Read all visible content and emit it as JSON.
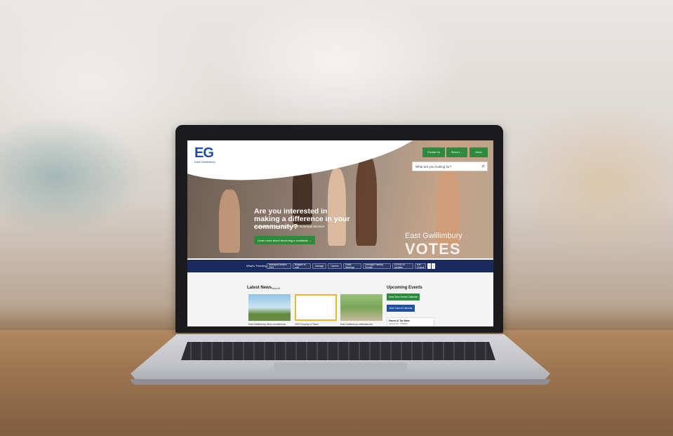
{
  "site": {
    "logo_text": "EG",
    "logo_sub": "East Gwillimbury",
    "header_buttons": [
      "Contact Us",
      "Select L...",
      "Menu"
    ],
    "search": {
      "placeholder": "What are you looking for?"
    }
  },
  "hero": {
    "headline": "Are you interested in making a difference in your community?",
    "subtext": "Registration is open for the 2022 municipal Election",
    "cta_label": "Learn more about becoming a candidate →",
    "badge_line1": "East Gwillimbury",
    "badge_line2": "VOTES"
  },
  "trending": {
    "label": "What's Trending",
    "items": [
      "Municipal Election 2022",
      "Register to vote",
      "Garbage",
      "Careers",
      "Public Meetings",
      "Overnight Parking Permits",
      "COVID-19 Updates",
      "Live Council"
    ]
  },
  "news": {
    "heading": "Latest News",
    "view_all": "View All",
    "items": [
      {
        "title": "East Gwillimbury offers condolences"
      },
      {
        "title": "2022 Property of Taxes"
      },
      {
        "title": "East Gwillimbury celebrates the"
      }
    ]
  },
  "events": {
    "heading": "Upcoming Events",
    "btn_town": "View Town Events Calendar",
    "btn_council": "View Council Calendar",
    "card_title": "Paved & Tar Mate",
    "card_date": "August 03 - 6:00PM"
  },
  "colors": {
    "accent_green": "#2e8b3e",
    "nav_blue": "#1b2a5e",
    "logo_blue": "#1f4fa0"
  }
}
